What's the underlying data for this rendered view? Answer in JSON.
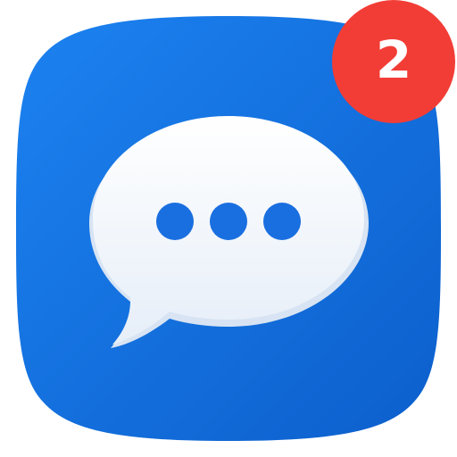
{
  "app_icon": {
    "name": "Messages",
    "icon": "chat-bubble-ellipsis-icon",
    "background_color": "#1877e8",
    "background_color_dark": "#0d62d0",
    "bubble_color": "#ffffff",
    "dot_color": "#1a6fe0"
  },
  "badge": {
    "count": "2",
    "color": "#f23d36",
    "text_color": "#ffffff"
  }
}
